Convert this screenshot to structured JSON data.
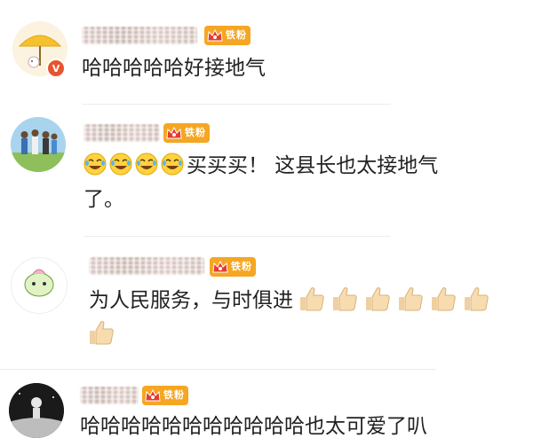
{
  "comments": [
    {
      "badge": "铁粉",
      "segments": [
        "哈哈哈哈哈好接地气"
      ],
      "emoji": "none",
      "verified": "V"
    },
    {
      "badge": "铁粉",
      "emoji_icon": "laughing-tears-emoji",
      "line1": "买买买！ 这县长也太接地气",
      "line2": "了。"
    },
    {
      "badge": "铁粉",
      "line1": "为人民服务，与时俱进",
      "thumb_icon": "thumbs-up-emoji"
    },
    {
      "badge": "铁粉",
      "line1": "哈哈哈哈哈哈哈哈哈哈哈也太可爱了叭"
    }
  ],
  "colors": {
    "badge": "#f5a623",
    "verified": "#e8542e",
    "text": "#222222"
  }
}
